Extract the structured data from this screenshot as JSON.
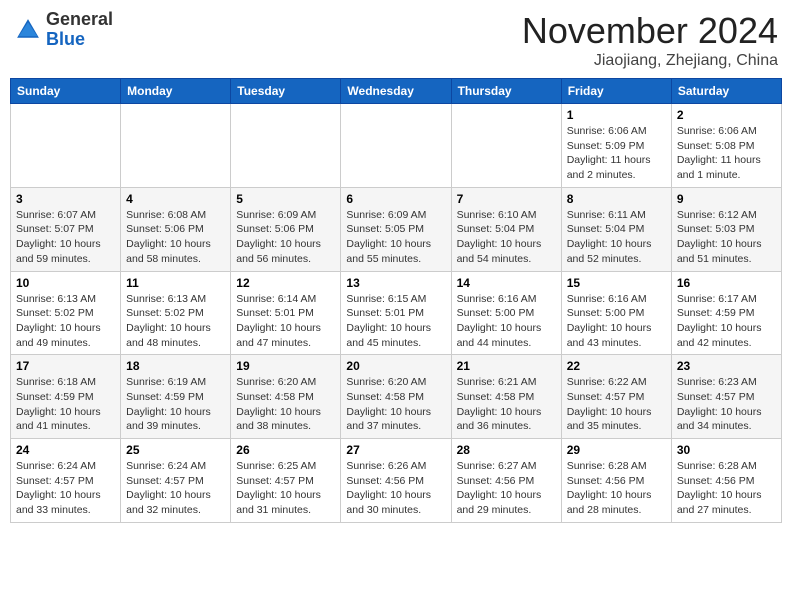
{
  "header": {
    "logo_general": "General",
    "logo_blue": "Blue",
    "month_year": "November 2024",
    "location": "Jiaojiang, Zhejiang, China"
  },
  "weekdays": [
    "Sunday",
    "Monday",
    "Tuesday",
    "Wednesday",
    "Thursday",
    "Friday",
    "Saturday"
  ],
  "weeks": [
    [
      {
        "day": "",
        "info": ""
      },
      {
        "day": "",
        "info": ""
      },
      {
        "day": "",
        "info": ""
      },
      {
        "day": "",
        "info": ""
      },
      {
        "day": "",
        "info": ""
      },
      {
        "day": "1",
        "info": "Sunrise: 6:06 AM\nSunset: 5:09 PM\nDaylight: 11 hours and 2 minutes."
      },
      {
        "day": "2",
        "info": "Sunrise: 6:06 AM\nSunset: 5:08 PM\nDaylight: 11 hours and 1 minute."
      }
    ],
    [
      {
        "day": "3",
        "info": "Sunrise: 6:07 AM\nSunset: 5:07 PM\nDaylight: 10 hours and 59 minutes."
      },
      {
        "day": "4",
        "info": "Sunrise: 6:08 AM\nSunset: 5:06 PM\nDaylight: 10 hours and 58 minutes."
      },
      {
        "day": "5",
        "info": "Sunrise: 6:09 AM\nSunset: 5:06 PM\nDaylight: 10 hours and 56 minutes."
      },
      {
        "day": "6",
        "info": "Sunrise: 6:09 AM\nSunset: 5:05 PM\nDaylight: 10 hours and 55 minutes."
      },
      {
        "day": "7",
        "info": "Sunrise: 6:10 AM\nSunset: 5:04 PM\nDaylight: 10 hours and 54 minutes."
      },
      {
        "day": "8",
        "info": "Sunrise: 6:11 AM\nSunset: 5:04 PM\nDaylight: 10 hours and 52 minutes."
      },
      {
        "day": "9",
        "info": "Sunrise: 6:12 AM\nSunset: 5:03 PM\nDaylight: 10 hours and 51 minutes."
      }
    ],
    [
      {
        "day": "10",
        "info": "Sunrise: 6:13 AM\nSunset: 5:02 PM\nDaylight: 10 hours and 49 minutes."
      },
      {
        "day": "11",
        "info": "Sunrise: 6:13 AM\nSunset: 5:02 PM\nDaylight: 10 hours and 48 minutes."
      },
      {
        "day": "12",
        "info": "Sunrise: 6:14 AM\nSunset: 5:01 PM\nDaylight: 10 hours and 47 minutes."
      },
      {
        "day": "13",
        "info": "Sunrise: 6:15 AM\nSunset: 5:01 PM\nDaylight: 10 hours and 45 minutes."
      },
      {
        "day": "14",
        "info": "Sunrise: 6:16 AM\nSunset: 5:00 PM\nDaylight: 10 hours and 44 minutes."
      },
      {
        "day": "15",
        "info": "Sunrise: 6:16 AM\nSunset: 5:00 PM\nDaylight: 10 hours and 43 minutes."
      },
      {
        "day": "16",
        "info": "Sunrise: 6:17 AM\nSunset: 4:59 PM\nDaylight: 10 hours and 42 minutes."
      }
    ],
    [
      {
        "day": "17",
        "info": "Sunrise: 6:18 AM\nSunset: 4:59 PM\nDaylight: 10 hours and 41 minutes."
      },
      {
        "day": "18",
        "info": "Sunrise: 6:19 AM\nSunset: 4:59 PM\nDaylight: 10 hours and 39 minutes."
      },
      {
        "day": "19",
        "info": "Sunrise: 6:20 AM\nSunset: 4:58 PM\nDaylight: 10 hours and 38 minutes."
      },
      {
        "day": "20",
        "info": "Sunrise: 6:20 AM\nSunset: 4:58 PM\nDaylight: 10 hours and 37 minutes."
      },
      {
        "day": "21",
        "info": "Sunrise: 6:21 AM\nSunset: 4:58 PM\nDaylight: 10 hours and 36 minutes."
      },
      {
        "day": "22",
        "info": "Sunrise: 6:22 AM\nSunset: 4:57 PM\nDaylight: 10 hours and 35 minutes."
      },
      {
        "day": "23",
        "info": "Sunrise: 6:23 AM\nSunset: 4:57 PM\nDaylight: 10 hours and 34 minutes."
      }
    ],
    [
      {
        "day": "24",
        "info": "Sunrise: 6:24 AM\nSunset: 4:57 PM\nDaylight: 10 hours and 33 minutes."
      },
      {
        "day": "25",
        "info": "Sunrise: 6:24 AM\nSunset: 4:57 PM\nDaylight: 10 hours and 32 minutes."
      },
      {
        "day": "26",
        "info": "Sunrise: 6:25 AM\nSunset: 4:57 PM\nDaylight: 10 hours and 31 minutes."
      },
      {
        "day": "27",
        "info": "Sunrise: 6:26 AM\nSunset: 4:56 PM\nDaylight: 10 hours and 30 minutes."
      },
      {
        "day": "28",
        "info": "Sunrise: 6:27 AM\nSunset: 4:56 PM\nDaylight: 10 hours and 29 minutes."
      },
      {
        "day": "29",
        "info": "Sunrise: 6:28 AM\nSunset: 4:56 PM\nDaylight: 10 hours and 28 minutes."
      },
      {
        "day": "30",
        "info": "Sunrise: 6:28 AM\nSunset: 4:56 PM\nDaylight: 10 hours and 27 minutes."
      }
    ]
  ]
}
